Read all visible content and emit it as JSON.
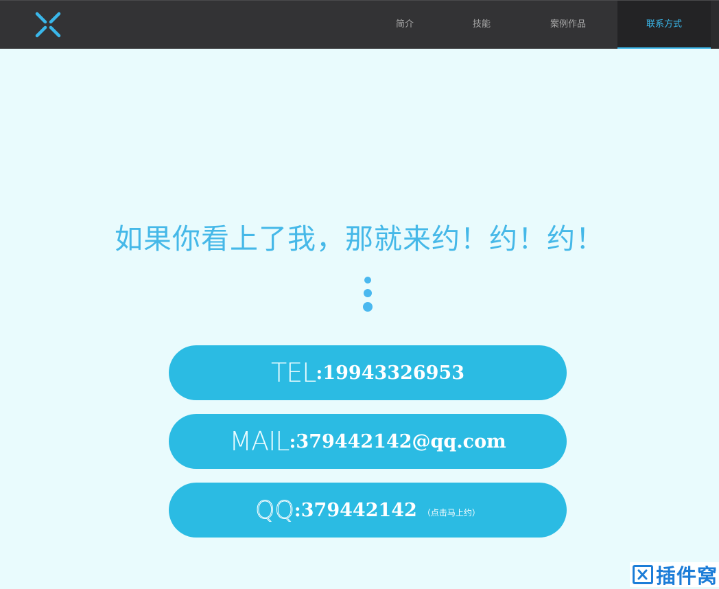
{
  "colors": {
    "nav_bg": "#333335",
    "nav_active_bg": "#232325",
    "accent": "#3ab7ea",
    "page_bg": "#e9fbfd",
    "pill_bg": "#2bbbe3",
    "watermark": "#1c7dd8"
  },
  "nav": {
    "logo_icon": "x-logo-icon",
    "items": [
      {
        "label": "简介",
        "active": false
      },
      {
        "label": "技能",
        "active": false
      },
      {
        "label": "案例作品",
        "active": false
      },
      {
        "label": "联系方式",
        "active": true
      }
    ]
  },
  "contact": {
    "headline": "如果你看上了我，那就来约！约！约！",
    "tel": {
      "label": "TEL",
      "value": ":19943326953"
    },
    "mail": {
      "label": "MAIL",
      "value": ":379442142@qq.com"
    },
    "qq": {
      "label": "QQ",
      "value": ":379442142",
      "note": "（点击马上约）"
    }
  },
  "watermark": {
    "icon": "plugin-nest-logo-icon",
    "text": "插件窝"
  }
}
